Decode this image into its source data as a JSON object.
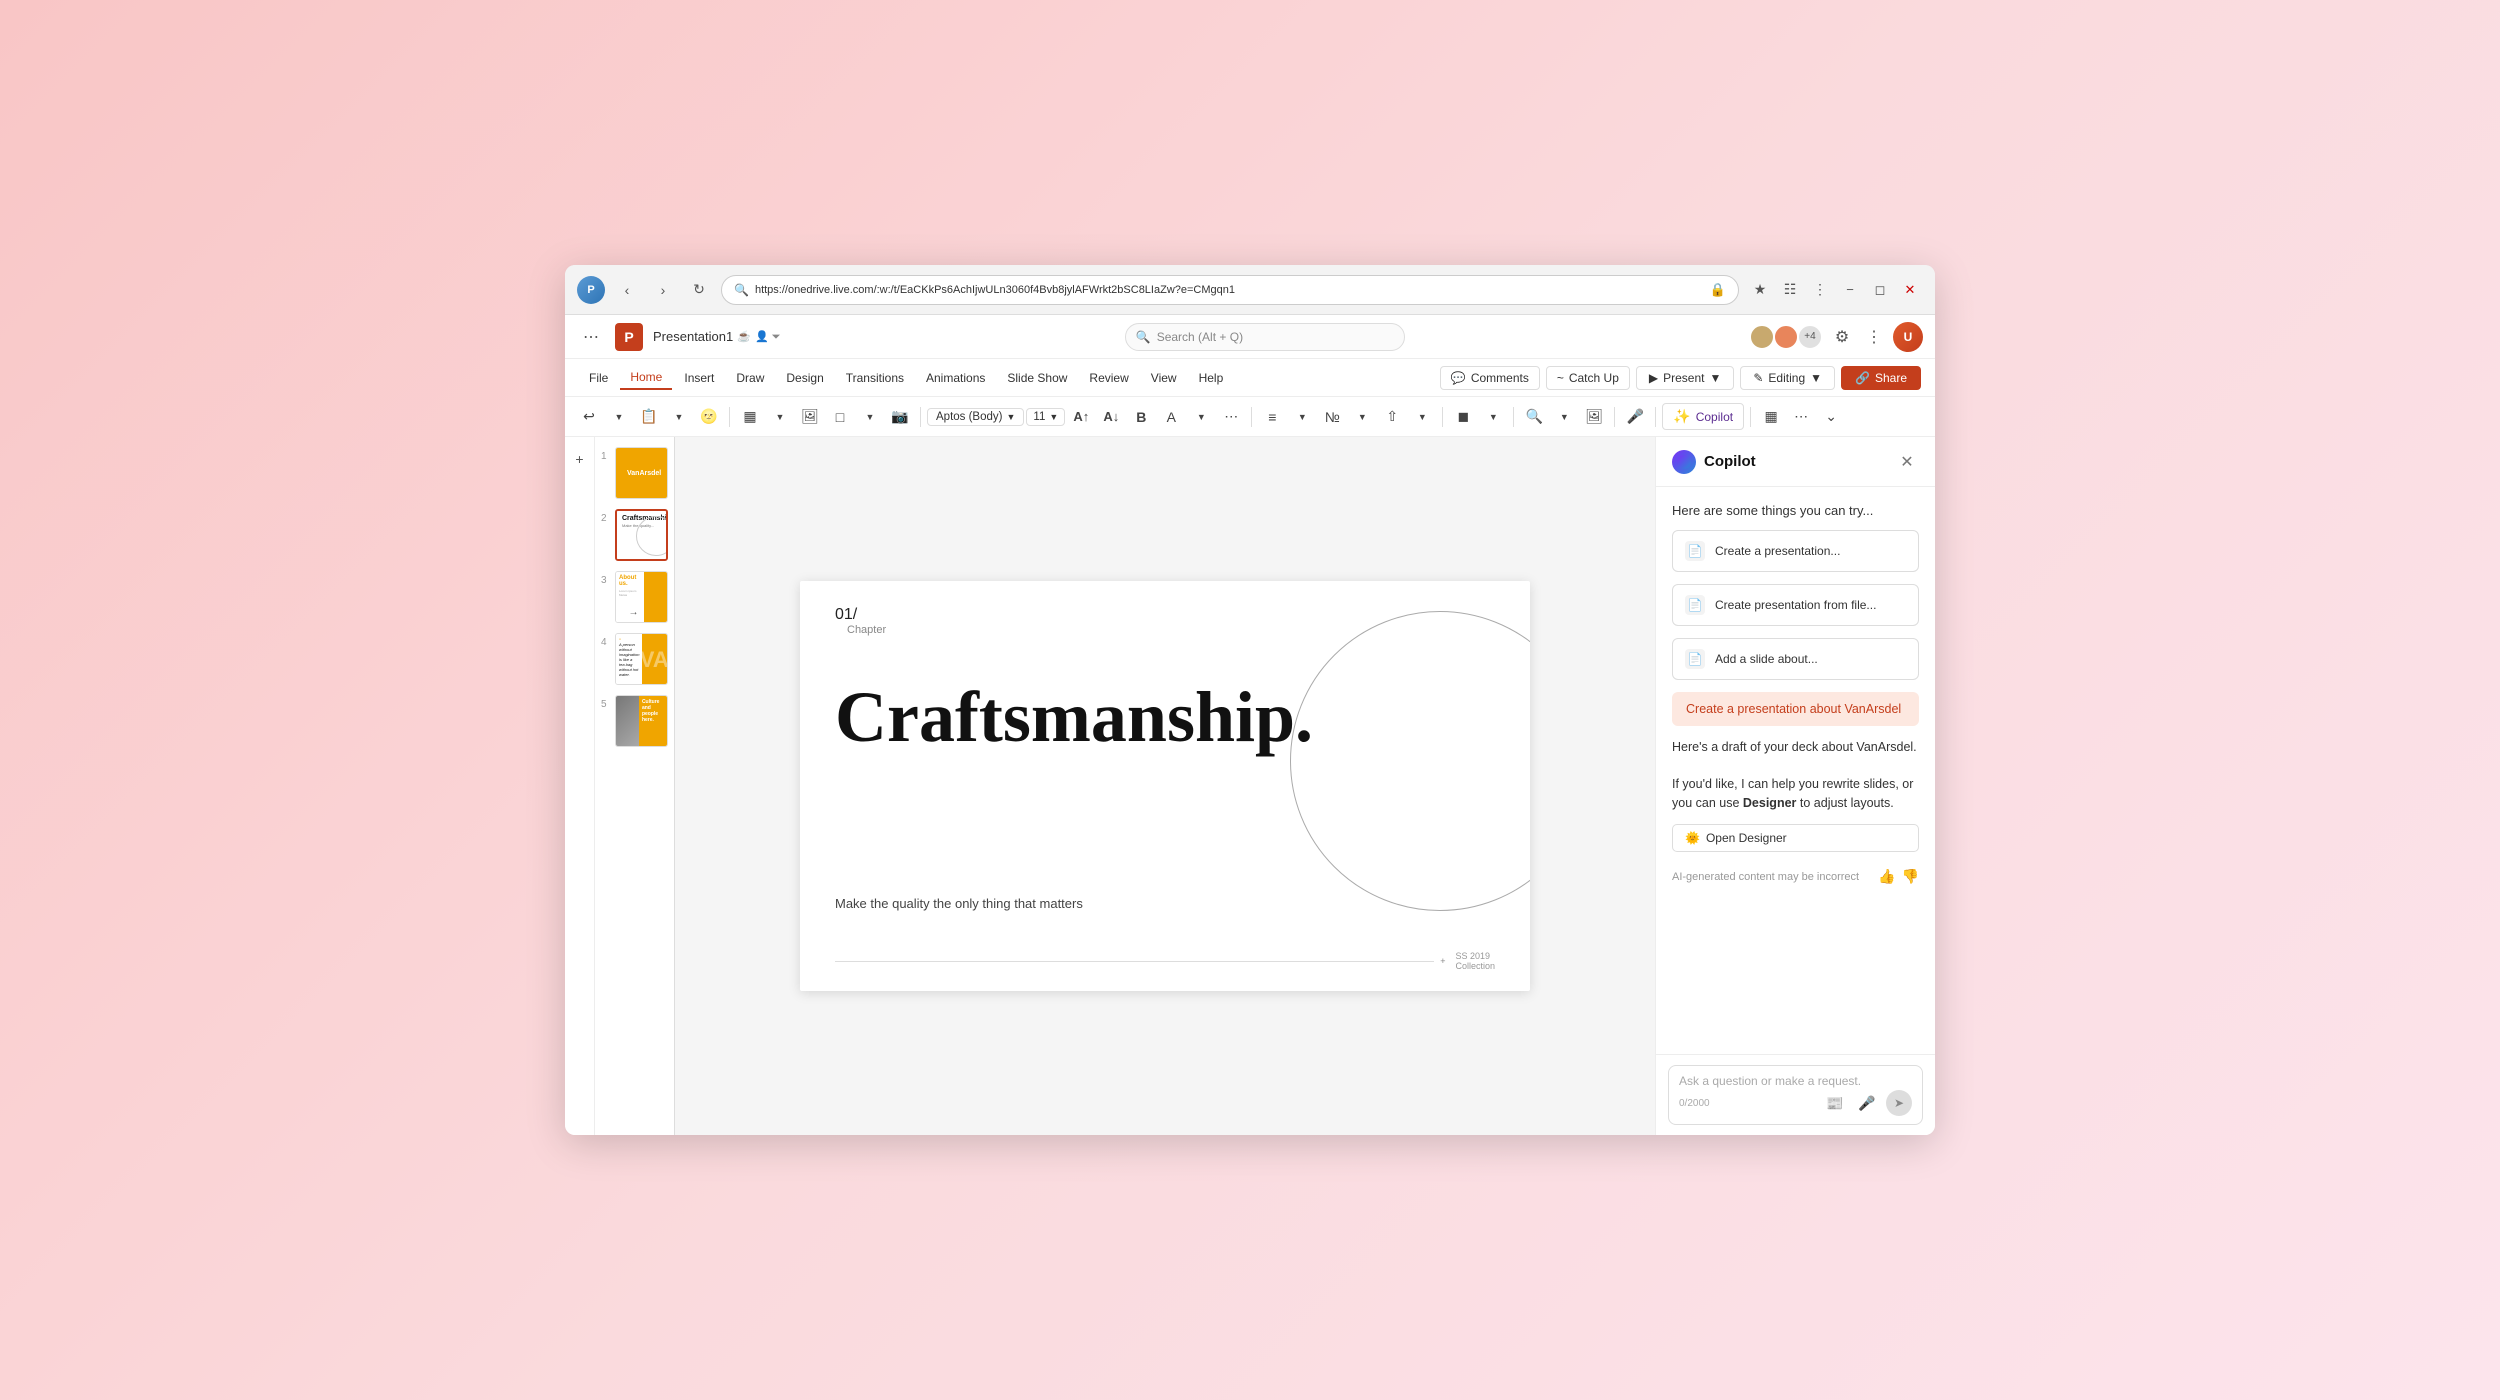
{
  "browser": {
    "url": "https://onedrive.live.com/:w:/t/EaCKkPs6AchIjwULn3060f4Bvb8jylAFWrkt2bSC8LIaZw?e=CMgqn1",
    "back_btn": "‹",
    "forward_btn": "›",
    "refresh_btn": "↺"
  },
  "app": {
    "logo": "P",
    "title": "Presentation1",
    "search_placeholder": "Search (Alt + Q)"
  },
  "menu": {
    "items": [
      "File",
      "Home",
      "Insert",
      "Draw",
      "Design",
      "Transitions",
      "Animations",
      "Slide Show",
      "Review",
      "View",
      "Help"
    ],
    "active": "Home",
    "comments_label": "Comments",
    "catchup_label": "Catch Up",
    "present_label": "Present",
    "editing_label": "Editing",
    "share_label": "Share"
  },
  "toolbar": {
    "font_name": "Aptos (Body)",
    "font_size": "11",
    "copilot_label": "Copilot"
  },
  "slides": [
    {
      "number": "1",
      "type": "yellow_title",
      "title": "VanArsdel"
    },
    {
      "number": "2",
      "type": "craftsmanship",
      "title": "Craftsmanship."
    },
    {
      "number": "3",
      "type": "about_us",
      "title": "About us."
    },
    {
      "number": "4",
      "type": "quote",
      "quote": "\"A person without imagination is like a tea bag without hot water.\""
    },
    {
      "number": "5",
      "type": "culture",
      "title": "Culture and people here."
    }
  ],
  "current_slide": {
    "chapter_number": "01/",
    "chapter_label": "Chapter",
    "title": "Craftsmanship.",
    "subtitle": "Make the quality the only thing that matters",
    "footer_text": "SS 2019\nCollection"
  },
  "copilot": {
    "title": "Copilot",
    "intro_text": "Here are some things you can try...",
    "suggestions": [
      "Create a presentation...",
      "Create presentation from file...",
      "Add a slide about..."
    ],
    "brand_button": "Create a presentation about VanArsdel",
    "response_para1": "Here's a draft of your deck about VanArsdel.",
    "response_para2": "If you'd like, I can help you rewrite slides, or you can use",
    "response_para2_link": "Designer",
    "response_para2_end": "to adjust layouts.",
    "open_designer_label": "Open Designer",
    "ai_disclaimer": "AI-generated content may be incorrect",
    "input_placeholder": "Ask a question or make a request.",
    "char_count": "0/2000"
  }
}
